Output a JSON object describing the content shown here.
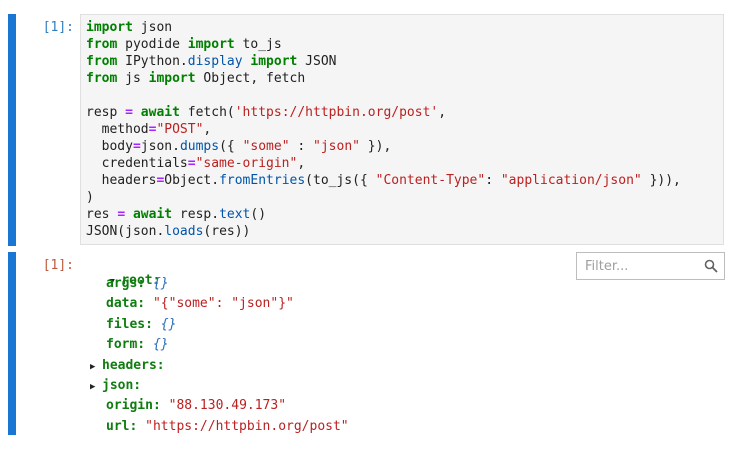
{
  "input_cell": {
    "prompt": "[1]:",
    "code_lines": [
      [
        [
          "kw",
          "import"
        ],
        [
          "t",
          " json"
        ]
      ],
      [
        [
          "kw",
          "from"
        ],
        [
          "t",
          " pyodide "
        ],
        [
          "kw",
          "import"
        ],
        [
          "t",
          " to_js"
        ]
      ],
      [
        [
          "kw",
          "from"
        ],
        [
          "t",
          " IPython."
        ],
        [
          "attr",
          "display"
        ],
        [
          "t",
          " "
        ],
        [
          "kw",
          "import"
        ],
        [
          "t",
          " JSON"
        ]
      ],
      [
        [
          "kw",
          "from"
        ],
        [
          "t",
          " js "
        ],
        [
          "kw",
          "import"
        ],
        [
          "t",
          " Object, fetch"
        ]
      ],
      [],
      [
        [
          "t",
          "resp "
        ],
        [
          "op",
          "="
        ],
        [
          "t",
          " "
        ],
        [
          "kw",
          "await"
        ],
        [
          "t",
          " fetch("
        ],
        [
          "str",
          "'https://httpbin.org/post'"
        ],
        [
          "t",
          ","
        ]
      ],
      [
        [
          "t",
          "  method"
        ],
        [
          "op",
          "="
        ],
        [
          "str",
          "\"POST\""
        ],
        [
          "t",
          ","
        ]
      ],
      [
        [
          "t",
          "  body"
        ],
        [
          "op",
          "="
        ],
        [
          "t",
          "json."
        ],
        [
          "attr",
          "dumps"
        ],
        [
          "t",
          "({ "
        ],
        [
          "str",
          "\"some\""
        ],
        [
          "t",
          " : "
        ],
        [
          "str",
          "\"json\""
        ],
        [
          "t",
          " }),"
        ]
      ],
      [
        [
          "t",
          "  credentials"
        ],
        [
          "op",
          "="
        ],
        [
          "str",
          "\"same-origin\""
        ],
        [
          "t",
          ","
        ]
      ],
      [
        [
          "t",
          "  headers"
        ],
        [
          "op",
          "="
        ],
        [
          "t",
          "Object."
        ],
        [
          "attr",
          "fromEntries"
        ],
        [
          "t",
          "(to_js({ "
        ],
        [
          "str",
          "\"Content-Type\""
        ],
        [
          "t",
          ": "
        ],
        [
          "str",
          "\"application/json\""
        ],
        [
          "t",
          " })),"
        ]
      ],
      [
        [
          "t",
          ")"
        ]
      ],
      [
        [
          "t",
          "res "
        ],
        [
          "op",
          "="
        ],
        [
          "t",
          " "
        ],
        [
          "kw",
          "await"
        ],
        [
          "t",
          " resp."
        ],
        [
          "attr",
          "text"
        ],
        [
          "t",
          "()"
        ]
      ],
      [
        [
          "t",
          "JSON(json."
        ],
        [
          "attr",
          "loads"
        ],
        [
          "t",
          "(res))"
        ]
      ]
    ]
  },
  "output_cell": {
    "prompt": "[1]:",
    "filter_placeholder": "Filter...",
    "root_label": "root:",
    "rows": [
      {
        "key": "args:",
        "value": "{}",
        "kind": "empty",
        "expandable": false
      },
      {
        "key": "data:",
        "value": "\"{\"some\": \"json\"}\"",
        "kind": "str",
        "expandable": false
      },
      {
        "key": "files:",
        "value": "{}",
        "kind": "empty",
        "expandable": false
      },
      {
        "key": "form:",
        "value": "{}",
        "kind": "empty",
        "expandable": false
      },
      {
        "key": "headers:",
        "value": "",
        "kind": "obj",
        "expandable": true
      },
      {
        "key": "json:",
        "value": "",
        "kind": "obj",
        "expandable": true
      },
      {
        "key": "origin:",
        "value": "\"88.130.49.173\"",
        "kind": "str",
        "expandable": false
      },
      {
        "key": "url:",
        "value": "\"https://httpbin.org/post\"",
        "kind": "str",
        "expandable": false
      }
    ]
  },
  "icons": {
    "filter": "search-icon",
    "expand": "caret-right-icon",
    "collapse": "caret-down-icon"
  },
  "colors": {
    "cell_bar": "#1976d2",
    "keyword": "#008000",
    "string": "#ba2121",
    "tree_key": "#0f7d0f"
  }
}
